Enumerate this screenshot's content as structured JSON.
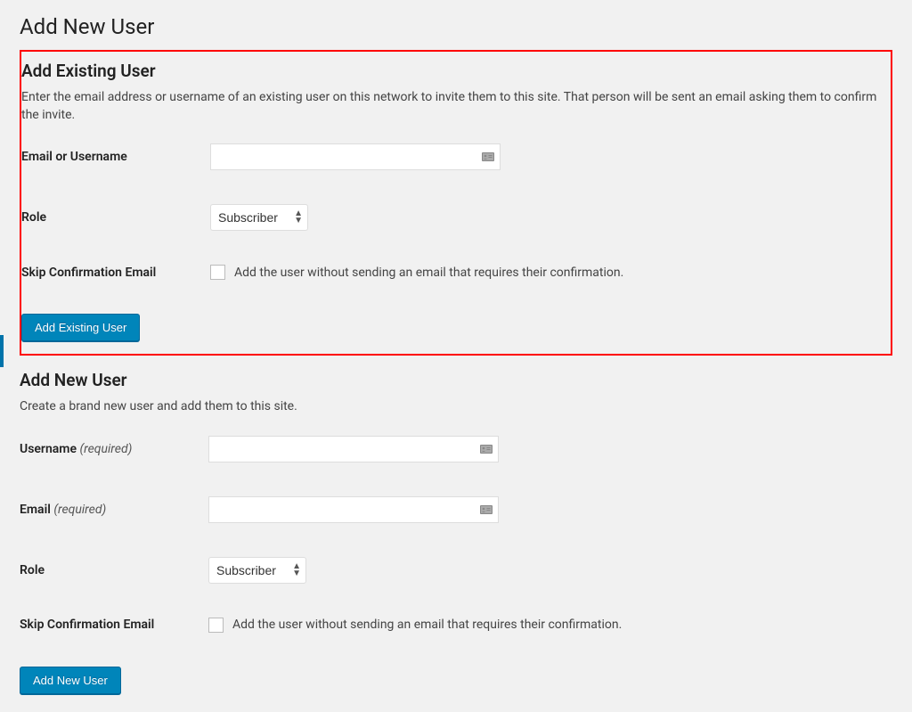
{
  "page": {
    "title": "Add New User"
  },
  "existing": {
    "heading": "Add Existing User",
    "description": "Enter the email address or username of an existing user on this network to invite them to this site. That person will be sent an email asking them to confirm the invite.",
    "email_label": "Email or Username",
    "role_label": "Role",
    "role_value": "Subscriber",
    "skip_label": "Skip Confirmation Email",
    "skip_help": "Add the user without sending an email that requires their confirmation.",
    "submit_label": "Add Existing User"
  },
  "newuser": {
    "heading": "Add New User",
    "description": "Create a brand new user and add them to this site.",
    "username_label": "Username",
    "username_req": "(required)",
    "email_label": "Email",
    "email_req": "(required)",
    "role_label": "Role",
    "role_value": "Subscriber",
    "skip_label": "Skip Confirmation Email",
    "skip_help": "Add the user without sending an email that requires their confirmation.",
    "submit_label": "Add New User"
  }
}
